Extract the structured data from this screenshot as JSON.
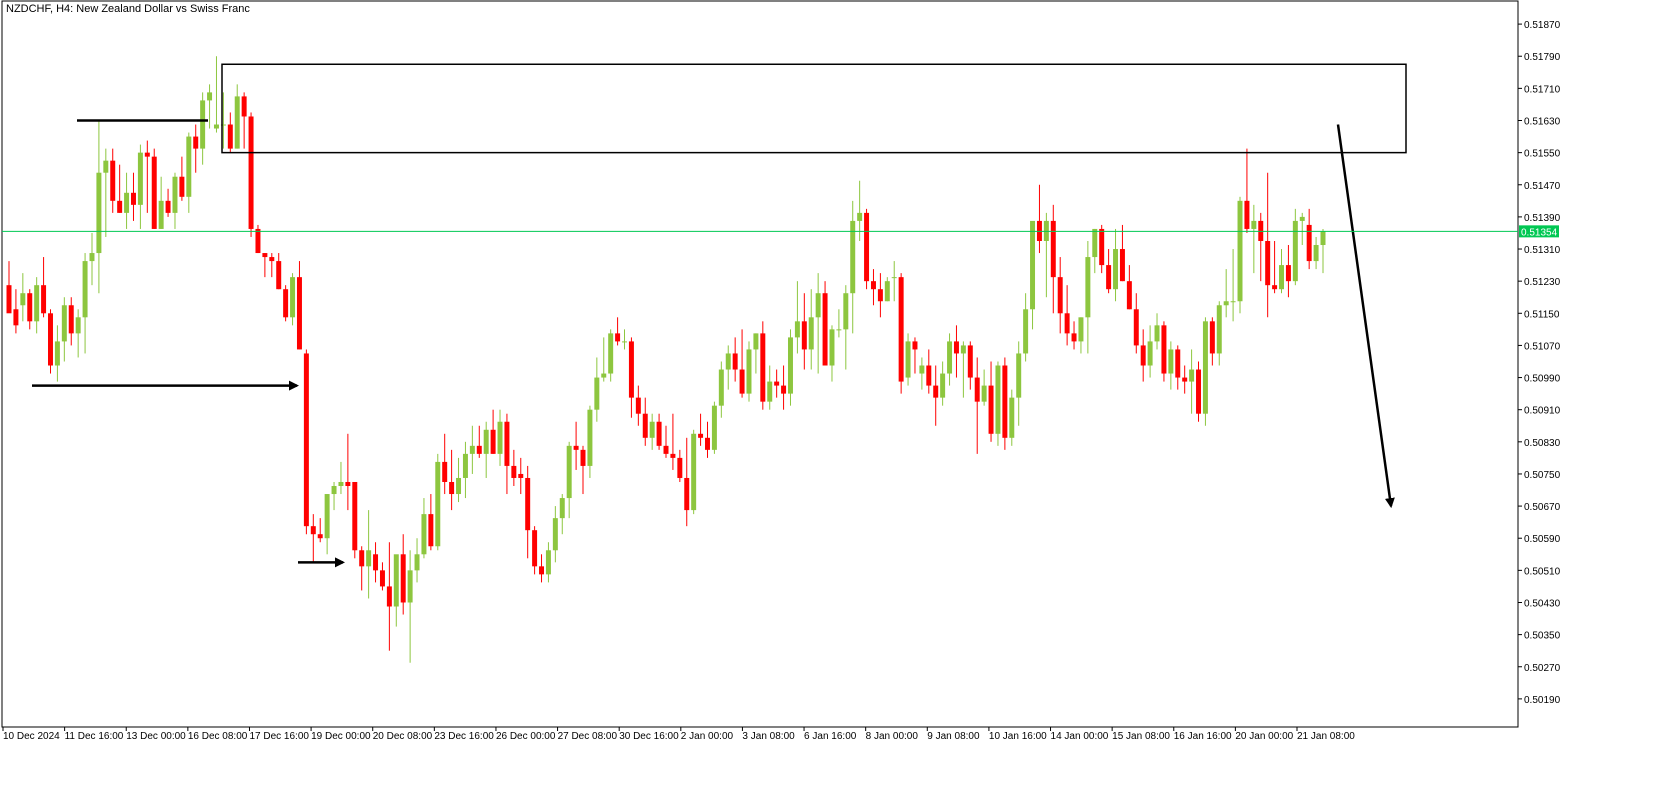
{
  "header": {
    "symbol_title": "NZDCHF, H4:  New Zealand Dollar vs Swiss Franc"
  },
  "colors": {
    "bull": "#8dc63f",
    "bear": "#ff0000",
    "price_line": "#00c853",
    "annotation": "#000000",
    "axis": "#000000",
    "background": "#ffffff"
  },
  "chart_data": {
    "type": "candlestick",
    "symbol": "NZDCHF",
    "timeframe": "H4",
    "ylim": [
      0.5012,
      0.5193
    ],
    "yticks": [
      "0.51870",
      "0.51790",
      "0.51710",
      "0.51630",
      "0.51550",
      "0.51470",
      "0.51390",
      "0.51310",
      "0.51230",
      "0.51150",
      "0.51070",
      "0.50990",
      "0.50910",
      "0.50830",
      "0.50750",
      "0.50670",
      "0.50590",
      "0.50510",
      "0.50430",
      "0.50350",
      "0.50270",
      "0.50190"
    ],
    "xticks": [
      "10 Dec 2024",
      "11 Dec 16:00",
      "13 Dec 00:00",
      "16 Dec 08:00",
      "17 Dec 16:00",
      "19 Dec 00:00",
      "20 Dec 08:00",
      "23 Dec 16:00",
      "26 Dec 00:00",
      "27 Dec 08:00",
      "30 Dec 16:00",
      "2 Jan 00:00",
      "3 Jan 08:00",
      "6 Jan 16:00",
      "8 Jan 00:00",
      "9 Jan 08:00",
      "10 Jan 16:00",
      "14 Jan 00:00",
      "15 Jan 08:00",
      "16 Jan 16:00",
      "20 Jan 00:00",
      "21 Jan 08:00"
    ],
    "current_price": "0.51354",
    "candles": [
      [
        0.5122,
        0.5128,
        0.5116,
        0.5115
      ],
      [
        0.5116,
        0.5121,
        0.511,
        0.5112
      ],
      [
        0.5117,
        0.5125,
        0.5113,
        0.512
      ],
      [
        0.512,
        0.5121,
        0.5111,
        0.5113
      ],
      [
        0.5113,
        0.5124,
        0.511,
        0.5122
      ],
      [
        0.5122,
        0.5129,
        0.5114,
        0.5115
      ],
      [
        0.5115,
        0.5116,
        0.51,
        0.5102
      ],
      [
        0.5102,
        0.5112,
        0.5098,
        0.5108
      ],
      [
        0.5108,
        0.5119,
        0.5103,
        0.5117
      ],
      [
        0.5117,
        0.5119,
        0.5107,
        0.511
      ],
      [
        0.511,
        0.5116,
        0.5104,
        0.5114
      ],
      [
        0.5114,
        0.513,
        0.5105,
        0.5128
      ],
      [
        0.5128,
        0.5135,
        0.5122,
        0.513
      ],
      [
        0.513,
        0.5163,
        0.512,
        0.515
      ],
      [
        0.515,
        0.5156,
        0.5134,
        0.5153
      ],
      [
        0.5153,
        0.5156,
        0.514,
        0.5143
      ],
      [
        0.5143,
        0.5152,
        0.514,
        0.514
      ],
      [
        0.514,
        0.515,
        0.5136,
        0.5145
      ],
      [
        0.5145,
        0.515,
        0.5138,
        0.5142
      ],
      [
        0.5142,
        0.5157,
        0.5136,
        0.5155
      ],
      [
        0.5155,
        0.5158,
        0.514,
        0.5154
      ],
      [
        0.5154,
        0.5156,
        0.5136,
        0.5136
      ],
      [
        0.5136,
        0.5149,
        0.5136,
        0.5143
      ],
      [
        0.5143,
        0.5146,
        0.5139,
        0.514
      ],
      [
        0.514,
        0.515,
        0.5136,
        0.5149
      ],
      [
        0.5149,
        0.5154,
        0.5143,
        0.5144
      ],
      [
        0.5144,
        0.516,
        0.514,
        0.5159
      ],
      [
        0.5159,
        0.5162,
        0.515,
        0.5156
      ],
      [
        0.5156,
        0.517,
        0.5152,
        0.5168
      ],
      [
        0.5168,
        0.5172,
        0.5161,
        0.517
      ],
      [
        0.5161,
        0.5179,
        0.516,
        0.5162
      ],
      [
        0.5162,
        0.517,
        0.5156,
        0.5162
      ],
      [
        0.5162,
        0.5165,
        0.5155,
        0.5156
      ],
      [
        0.5156,
        0.5172,
        0.5156,
        0.5169
      ],
      [
        0.5169,
        0.517,
        0.5156,
        0.5164
      ],
      [
        0.5164,
        0.5165,
        0.5134,
        0.5136
      ],
      [
        0.5136,
        0.5137,
        0.513,
        0.513
      ],
      [
        0.513,
        0.513,
        0.5124,
        0.5129
      ],
      [
        0.5129,
        0.513,
        0.5124,
        0.5128
      ],
      [
        0.5128,
        0.513,
        0.5121,
        0.5121
      ],
      [
        0.5121,
        0.5122,
        0.5113,
        0.5114
      ],
      [
        0.5114,
        0.5125,
        0.5112,
        0.5124
      ],
      [
        0.5124,
        0.5128,
        0.5106,
        0.5106
      ],
      [
        0.5105,
        0.5106,
        0.506,
        0.5062
      ],
      [
        0.5062,
        0.5065,
        0.5053,
        0.506
      ],
      [
        0.506,
        0.5064,
        0.5058,
        0.5059
      ],
      [
        0.5059,
        0.507,
        0.5055,
        0.507
      ],
      [
        0.507,
        0.5073,
        0.5066,
        0.5072
      ],
      [
        0.5072,
        0.5078,
        0.507,
        0.5073
      ],
      [
        0.5073,
        0.5085,
        0.5066,
        0.5072
      ],
      [
        0.5073,
        0.5073,
        0.5054,
        0.5056
      ],
      [
        0.5056,
        0.5057,
        0.5046,
        0.5052
      ],
      [
        0.5052,
        0.5066,
        0.5044,
        0.5056
      ],
      [
        0.5055,
        0.5058,
        0.5048,
        0.5051
      ],
      [
        0.5051,
        0.5053,
        0.5046,
        0.5047
      ],
      [
        0.5047,
        0.5058,
        0.5031,
        0.5042
      ],
      [
        0.5042,
        0.5054,
        0.5037,
        0.5055
      ],
      [
        0.5055,
        0.506,
        0.504,
        0.5043
      ],
      [
        0.5043,
        0.5056,
        0.5028,
        0.5051
      ],
      [
        0.5051,
        0.5059,
        0.5048,
        0.5055
      ],
      [
        0.5055,
        0.5069,
        0.5054,
        0.5065
      ],
      [
        0.5065,
        0.507,
        0.5056,
        0.5057
      ],
      [
        0.5057,
        0.508,
        0.5056,
        0.5078
      ],
      [
        0.5078,
        0.5085,
        0.507,
        0.5073
      ],
      [
        0.5073,
        0.5081,
        0.5066,
        0.507
      ],
      [
        0.507,
        0.5079,
        0.5068,
        0.5074
      ],
      [
        0.5074,
        0.5083,
        0.5069,
        0.508
      ],
      [
        0.508,
        0.5087,
        0.5075,
        0.5082
      ],
      [
        0.5082,
        0.5087,
        0.5079,
        0.508
      ],
      [
        0.508,
        0.5088,
        0.5074,
        0.5086
      ],
      [
        0.5086,
        0.5091,
        0.508,
        0.508
      ],
      [
        0.508,
        0.5091,
        0.5077,
        0.5088
      ],
      [
        0.5088,
        0.509,
        0.507,
        0.5077
      ],
      [
        0.5077,
        0.5081,
        0.5072,
        0.5074
      ],
      [
        0.5075,
        0.5079,
        0.507,
        0.5074
      ],
      [
        0.5074,
        0.5077,
        0.5054,
        0.5061
      ],
      [
        0.5061,
        0.5062,
        0.505,
        0.5052
      ],
      [
        0.5052,
        0.5055,
        0.5048,
        0.505
      ],
      [
        0.505,
        0.5058,
        0.5048,
        0.5056
      ],
      [
        0.5056,
        0.5067,
        0.5053,
        0.5064
      ],
      [
        0.5064,
        0.507,
        0.506,
        0.5069
      ],
      [
        0.5069,
        0.5083,
        0.5064,
        0.5082
      ],
      [
        0.5082,
        0.5088,
        0.5076,
        0.5081
      ],
      [
        0.5081,
        0.5082,
        0.507,
        0.5077
      ],
      [
        0.5077,
        0.5092,
        0.5074,
        0.5091
      ],
      [
        0.5091,
        0.5104,
        0.5088,
        0.5099
      ],
      [
        0.5099,
        0.5109,
        0.5098,
        0.51
      ],
      [
        0.51,
        0.5111,
        0.5098,
        0.511
      ],
      [
        0.511,
        0.5114,
        0.5107,
        0.5108
      ],
      [
        0.5108,
        0.5111,
        0.5106,
        0.5108
      ],
      [
        0.5108,
        0.5109,
        0.5089,
        0.5094
      ],
      [
        0.5094,
        0.5097,
        0.5087,
        0.509
      ],
      [
        0.509,
        0.5094,
        0.5082,
        0.5084
      ],
      [
        0.5084,
        0.509,
        0.5081,
        0.5088
      ],
      [
        0.5088,
        0.509,
        0.5081,
        0.5082
      ],
      [
        0.5082,
        0.5087,
        0.5079,
        0.508
      ],
      [
        0.508,
        0.509,
        0.5076,
        0.5079
      ],
      [
        0.5079,
        0.5081,
        0.5073,
        0.5074
      ],
      [
        0.5074,
        0.5084,
        0.5062,
        0.5066
      ],
      [
        0.5066,
        0.5086,
        0.5065,
        0.5085
      ],
      [
        0.5085,
        0.509,
        0.5082,
        0.5084
      ],
      [
        0.5084,
        0.5088,
        0.5079,
        0.5081
      ],
      [
        0.5081,
        0.5093,
        0.508,
        0.5092
      ],
      [
        0.5092,
        0.5103,
        0.5089,
        0.5101
      ],
      [
        0.5101,
        0.5107,
        0.5096,
        0.5105
      ],
      [
        0.5105,
        0.5109,
        0.5098,
        0.5101
      ],
      [
        0.5101,
        0.5111,
        0.5094,
        0.5095
      ],
      [
        0.5095,
        0.5108,
        0.5093,
        0.5106
      ],
      [
        0.5106,
        0.511,
        0.51,
        0.511
      ],
      [
        0.511,
        0.5113,
        0.5091,
        0.5093
      ],
      [
        0.5093,
        0.5102,
        0.5091,
        0.5098
      ],
      [
        0.5098,
        0.5101,
        0.5094,
        0.5097
      ],
      [
        0.5097,
        0.5102,
        0.5091,
        0.5095
      ],
      [
        0.5095,
        0.5111,
        0.5092,
        0.5109
      ],
      [
        0.5109,
        0.5123,
        0.5105,
        0.5113
      ],
      [
        0.5113,
        0.512,
        0.5101,
        0.5106
      ],
      [
        0.5106,
        0.5121,
        0.5101,
        0.5114
      ],
      [
        0.5114,
        0.5125,
        0.51,
        0.512
      ],
      [
        0.512,
        0.5123,
        0.5102,
        0.5102
      ],
      [
        0.5102,
        0.5112,
        0.5098,
        0.5111
      ],
      [
        0.5111,
        0.5116,
        0.5109,
        0.5111
      ],
      [
        0.5111,
        0.5122,
        0.5101,
        0.512
      ],
      [
        0.512,
        0.5143,
        0.511,
        0.5138
      ],
      [
        0.5138,
        0.5148,
        0.5133,
        0.514
      ],
      [
        0.514,
        0.5141,
        0.5121,
        0.5123
      ],
      [
        0.5123,
        0.5126,
        0.5117,
        0.5121
      ],
      [
        0.5121,
        0.5125,
        0.5114,
        0.5118
      ],
      [
        0.5118,
        0.5124,
        0.5118,
        0.5123
      ],
      [
        0.5124,
        0.5128,
        0.5118,
        0.5124
      ],
      [
        0.5124,
        0.5125,
        0.5095,
        0.5098
      ],
      [
        0.5099,
        0.511,
        0.5097,
        0.5108
      ],
      [
        0.5108,
        0.5109,
        0.51,
        0.5106
      ],
      [
        0.51,
        0.5104,
        0.5096,
        0.5102
      ],
      [
        0.5102,
        0.5106,
        0.5095,
        0.5097
      ],
      [
        0.5097,
        0.5102,
        0.5087,
        0.5094
      ],
      [
        0.5094,
        0.5103,
        0.5092,
        0.51
      ],
      [
        0.51,
        0.511,
        0.5097,
        0.5108
      ],
      [
        0.5108,
        0.5112,
        0.5099,
        0.5105
      ],
      [
        0.5105,
        0.5108,
        0.5094,
        0.5107
      ],
      [
        0.5107,
        0.5108,
        0.5096,
        0.5099
      ],
      [
        0.5099,
        0.5104,
        0.508,
        0.5093
      ],
      [
        0.5093,
        0.5101,
        0.5092,
        0.5097
      ],
      [
        0.5097,
        0.5103,
        0.5083,
        0.5085
      ],
      [
        0.5085,
        0.5103,
        0.5082,
        0.5102
      ],
      [
        0.5102,
        0.5104,
        0.5081,
        0.5084
      ],
      [
        0.5084,
        0.5096,
        0.5082,
        0.5094
      ],
      [
        0.5094,
        0.5108,
        0.5087,
        0.5105
      ],
      [
        0.5105,
        0.512,
        0.5103,
        0.5116
      ],
      [
        0.5116,
        0.5135,
        0.5111,
        0.5138
      ],
      [
        0.5138,
        0.5147,
        0.513,
        0.5133
      ],
      [
        0.5133,
        0.514,
        0.5119,
        0.5138
      ],
      [
        0.5138,
        0.5142,
        0.5115,
        0.5124
      ],
      [
        0.5124,
        0.5129,
        0.511,
        0.5115
      ],
      [
        0.5115,
        0.5122,
        0.5107,
        0.511
      ],
      [
        0.511,
        0.5113,
        0.5106,
        0.5108
      ],
      [
        0.5108,
        0.5114,
        0.5105,
        0.5114
      ],
      [
        0.5114,
        0.5133,
        0.5105,
        0.5129
      ],
      [
        0.5129,
        0.5136,
        0.5125,
        0.5136
      ],
      [
        0.5136,
        0.5137,
        0.5125,
        0.5127
      ],
      [
        0.5127,
        0.5131,
        0.512,
        0.5121
      ],
      [
        0.5121,
        0.5136,
        0.5118,
        0.5131
      ],
      [
        0.5131,
        0.5137,
        0.5123,
        0.5123
      ],
      [
        0.5123,
        0.5127,
        0.5116,
        0.5116
      ],
      [
        0.5116,
        0.512,
        0.5105,
        0.5107
      ],
      [
        0.5107,
        0.5111,
        0.5098,
        0.5102
      ],
      [
        0.5102,
        0.5112,
        0.5099,
        0.5108
      ],
      [
        0.5108,
        0.5115,
        0.5106,
        0.5112
      ],
      [
        0.5112,
        0.5113,
        0.5098,
        0.51
      ],
      [
        0.51,
        0.5108,
        0.5096,
        0.5106
      ],
      [
        0.5106,
        0.5107,
        0.5096,
        0.5099
      ],
      [
        0.5099,
        0.5102,
        0.5095,
        0.5098
      ],
      [
        0.5098,
        0.5106,
        0.509,
        0.5101
      ],
      [
        0.5101,
        0.5103,
        0.5088,
        0.509
      ],
      [
        0.509,
        0.5114,
        0.5087,
        0.5113
      ],
      [
        0.5113,
        0.5114,
        0.5102,
        0.5105
      ],
      [
        0.5105,
        0.5118,
        0.5102,
        0.5117
      ],
      [
        0.5117,
        0.5126,
        0.5114,
        0.5118
      ],
      [
        0.5118,
        0.5131,
        0.5113,
        0.5118
      ],
      [
        0.5118,
        0.5144,
        0.5115,
        0.5143
      ],
      [
        0.5143,
        0.5156,
        0.5135,
        0.5136
      ],
      [
        0.5136,
        0.5142,
        0.5125,
        0.5138
      ],
      [
        0.5138,
        0.514,
        0.5123,
        0.5133
      ],
      [
        0.5133,
        0.515,
        0.5114,
        0.5122
      ],
      [
        0.5122,
        0.5133,
        0.512,
        0.5121
      ],
      [
        0.5121,
        0.5131,
        0.512,
        0.5127
      ],
      [
        0.5127,
        0.5132,
        0.5119,
        0.5123
      ],
      [
        0.5123,
        0.5141,
        0.5122,
        0.5138
      ],
      [
        0.5138,
        0.514,
        0.5132,
        0.5139
      ],
      [
        0.5137,
        0.5141,
        0.5126,
        0.5128
      ],
      [
        0.5128,
        0.5134,
        0.5126,
        0.5132
      ],
      [
        0.5132,
        0.5136,
        0.5125,
        0.51354
      ]
    ]
  }
}
